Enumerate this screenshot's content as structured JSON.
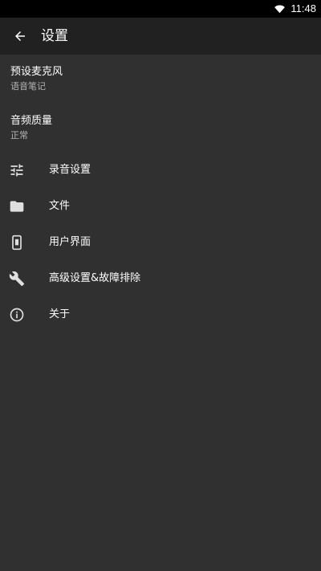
{
  "status_bar": {
    "time": "11:48",
    "icons": [
      "wifi-icon"
    ]
  },
  "toolbar": {
    "back_icon": "arrow-back-icon",
    "title": "设置"
  },
  "preferences": [
    {
      "title": "预设麦克风",
      "summary": "语音笔记"
    },
    {
      "title": "音频质量",
      "summary": "正常"
    }
  ],
  "menu": [
    {
      "label": "录音设置",
      "icon": "tune-sliders-icon"
    },
    {
      "label": "文件",
      "icon": "folder-icon"
    },
    {
      "label": "用户界面",
      "icon": "phone-screen-icon"
    },
    {
      "label": "高级设置&故障排除",
      "icon": "wrench-icon"
    },
    {
      "label": "关于",
      "icon": "info-icon"
    }
  ],
  "colors": {
    "background": "#303030",
    "toolbar": "#212121",
    "status_bar": "#000000",
    "text_primary": "#ffffff",
    "text_secondary": "#b4b4b4"
  }
}
